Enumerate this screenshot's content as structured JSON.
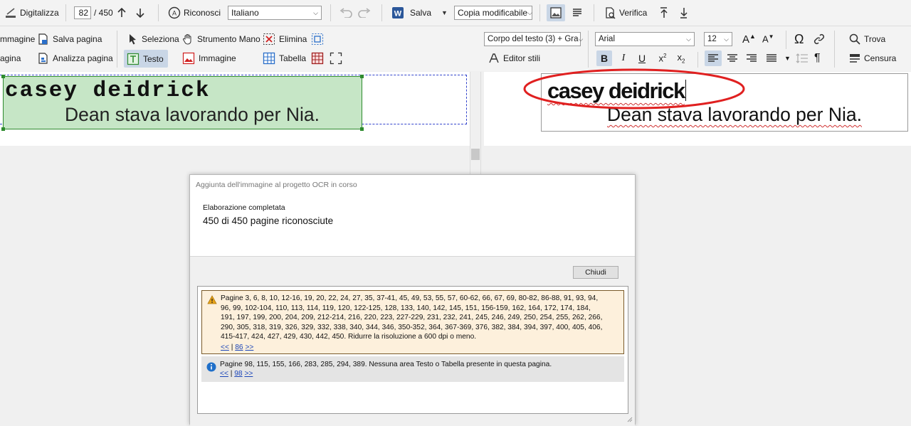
{
  "toolbar": {
    "scan_label": "Digitalizza",
    "page_current": "82",
    "page_total": "/ 450",
    "recognize_label": "Riconosci",
    "language_value": "Italiano",
    "save_label": "Salva",
    "copy_mode_value": "Copia modificabile",
    "verify_label": "Verifica"
  },
  "left_ribbon": {
    "image_label": "mmagine",
    "page_label": "agina",
    "save_page_label": "Salva pagina",
    "analyze_page_label": "Analizza pagina",
    "select_label": "Seleziona",
    "hand_tool_label": "Strumento Mano",
    "delete_label": "Elimina",
    "text_label": "Testo",
    "image_area_label": "Immagine",
    "table_label": "Tabella"
  },
  "right_ribbon": {
    "style_value": "Corpo del testo (3) + Gra",
    "style_editor_label": "Editor stili",
    "font_value": "Arial",
    "size_value": "12",
    "find_label": "Trova",
    "redact_label": "Censura"
  },
  "document": {
    "line1": "casey deidrick",
    "line2": "Dean stava lavorando per Nia."
  },
  "dialog": {
    "title": "Aggiunta dell'immagine al progetto OCR in corso",
    "status_heading": "Elaborazione completata",
    "status_text": "450 di 450 pagine riconosciute",
    "close_label": "Chiudi",
    "warning_text": "Pagine 3, 6, 8, 10, 12-16, 19, 20, 22, 24, 27, 35, 37-41, 45, 49, 53, 55, 57, 60-62, 66, 67, 69, 80-82, 86-88, 91, 93, 94, 96, 99, 102-104, 110, 113, 114, 119, 120, 122-125, 128, 133, 140, 142, 145, 151, 156-159, 162, 164, 172, 174, 184, 191, 197, 199, 200, 204, 209, 212-214, 216, 220, 223, 227-229, 231, 232, 241, 245, 246, 249, 250, 254, 255, 262, 266, 290, 305, 318, 319, 326, 329, 332, 338, 340, 344, 346, 350-352, 364, 367-369, 376, 382, 384, 394, 397, 400, 405, 406, 415-417, 424, 427, 429, 430, 442, 450. Ridurre la risoluzione a 600 dpi o meno.",
    "warning_prev": "<<",
    "warning_sep": "|",
    "warning_page": "86",
    "warning_next": ">>",
    "info_text": "Pagine 98, 115, 155, 166, 283, 285, 294, 389. Nessuna area Testo o Tabella presente in questa pagina.",
    "info_prev": "<<",
    "info_sep": "|",
    "info_page": "98",
    "info_next": ">>"
  },
  "colors": {
    "text_area_fill": "#c6e6c6",
    "text_area_border": "#2e8b2e",
    "annotation_ellipse": "#e02020",
    "warning_bg": "#fdf0dc",
    "warning_border": "#7a5a2a",
    "info_bg": "#e4e4e4",
    "info_icon": "#1f6fc9",
    "word_blue": "#2b579a"
  }
}
